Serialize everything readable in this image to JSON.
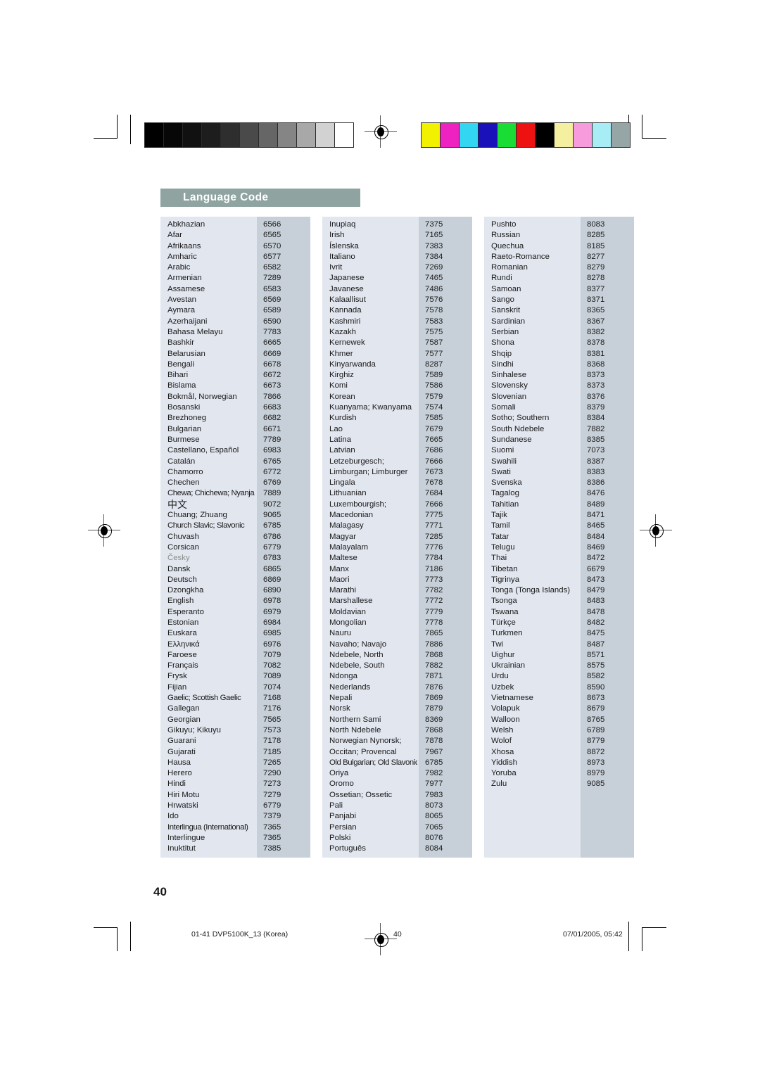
{
  "page": {
    "heading": "Language Code",
    "page_number": "40",
    "accent_header_color": "#8fa4a0",
    "name_column_color": "#e2e6ef",
    "code_column_color": "#c7d0d8"
  },
  "footer": {
    "file": "01-41 DVP5100K_13 (Korea)",
    "page": "40",
    "date": "07/01/2005, 05:42"
  },
  "calibration": {
    "grayscale": [
      "#000000",
      "#070707",
      "#111111",
      "#1d1d1d",
      "#2e2e2e",
      "#4a4a4a",
      "#666666",
      "#858585",
      "#a8a8a8",
      "#d2d2d2",
      "#ffffff"
    ],
    "colors": [
      "#f2f200",
      "#ee22c0",
      "#33d6f2",
      "#1a11bb",
      "#19dd34",
      "#ee1111",
      "#000000",
      "#f5f0a0",
      "#f79bdd",
      "#a8ecf5",
      "#96a5a5"
    ]
  },
  "table": {
    "columns": [
      {
        "id": "column-1",
        "rows": [
          {
            "name": "Abkhazian",
            "code": "6566"
          },
          {
            "name": "Afar",
            "code": "6565"
          },
          {
            "name": "Afrikaans",
            "code": "6570"
          },
          {
            "name": "Amharic",
            "code": "6577"
          },
          {
            "name": "Arabic",
            "code": "6582"
          },
          {
            "name": "Armenian",
            "code": "7289"
          },
          {
            "name": "Assamese",
            "code": "6583"
          },
          {
            "name": "Avestan",
            "code": "6569"
          },
          {
            "name": "Aymara",
            "code": "6589"
          },
          {
            "name": "Azerhaijani",
            "code": "6590"
          },
          {
            "name": "Bahasa Melayu",
            "code": "7783"
          },
          {
            "name": "Bashkir",
            "code": "6665"
          },
          {
            "name": "Belarusian",
            "code": "6669"
          },
          {
            "name": "Bengali",
            "code": "6678"
          },
          {
            "name": "Bihari",
            "code": "6672"
          },
          {
            "name": "Bislama",
            "code": "6673"
          },
          {
            "name": "Bokmål, Norwegian",
            "code": "7866"
          },
          {
            "name": "Bosanski",
            "code": "6683"
          },
          {
            "name": "Brezhoneg",
            "code": "6682"
          },
          {
            "name": "Bulgarian",
            "code": "6671"
          },
          {
            "name": "Burmese",
            "code": "7789"
          },
          {
            "name": "Castellano, Español",
            "code": "6983"
          },
          {
            "name": "Catalán",
            "code": "6765"
          },
          {
            "name": "Chamorro",
            "code": "6772"
          },
          {
            "name": "Chechen",
            "code": "6769"
          },
          {
            "name": "Chewa; Chichewa; Nyanja",
            "code": "7889"
          },
          {
            "name": "中文",
            "code": "9072"
          },
          {
            "name": "Chuang; Zhuang",
            "code": "9065"
          },
          {
            "name": "Church Slavic; Slavonic",
            "code": "6785"
          },
          {
            "name": "Chuvash",
            "code": "6786"
          },
          {
            "name": "Corsican",
            "code": "6779"
          },
          {
            "name": "Česky",
            "code": "6783"
          },
          {
            "name": "Dansk",
            "code": "6865"
          },
          {
            "name": "Deutsch",
            "code": "6869"
          },
          {
            "name": "Dzongkha",
            "code": "6890"
          },
          {
            "name": "English",
            "code": "6978"
          },
          {
            "name": "Esperanto",
            "code": "6979"
          },
          {
            "name": "Estonian",
            "code": "6984"
          },
          {
            "name": "Euskara",
            "code": "6985"
          },
          {
            "name": "Ελληνικά",
            "code": "6976"
          },
          {
            "name": "Faroese",
            "code": "7079"
          },
          {
            "name": "Français",
            "code": "7082"
          },
          {
            "name": "Frysk",
            "code": "7089"
          },
          {
            "name": "Fijian",
            "code": "7074"
          },
          {
            "name": "Gaelic; Scottish Gaelic",
            "code": "7168"
          },
          {
            "name": "Gallegan",
            "code": "7176"
          },
          {
            "name": "Georgian",
            "code": "7565"
          },
          {
            "name": "Gikuyu; Kikuyu",
            "code": "7573"
          },
          {
            "name": "Guarani",
            "code": "7178"
          },
          {
            "name": "Gujarati",
            "code": "7185"
          },
          {
            "name": "Hausa",
            "code": "7265"
          },
          {
            "name": "Herero",
            "code": "7290"
          },
          {
            "name": "Hindi",
            "code": "7273"
          },
          {
            "name": "Hiri Motu",
            "code": "7279"
          },
          {
            "name": "Hrwatski",
            "code": "6779"
          },
          {
            "name": "Ido",
            "code": "7379"
          },
          {
            "name": "Interlingua (International)",
            "code": "7365"
          },
          {
            "name": "Interlingue",
            "code": "7365"
          },
          {
            "name": "Inuktitut",
            "code": "7385"
          }
        ]
      },
      {
        "id": "column-2",
        "rows": [
          {
            "name": "Inupiaq",
            "code": "7375"
          },
          {
            "name": "Irish",
            "code": "7165"
          },
          {
            "name": "Íslenska",
            "code": "7383"
          },
          {
            "name": "Italiano",
            "code": "7384"
          },
          {
            "name": "Ivrit",
            "code": "7269"
          },
          {
            "name": "Japanese",
            "code": "7465"
          },
          {
            "name": "Javanese",
            "code": "7486"
          },
          {
            "name": "Kalaallisut",
            "code": "7576"
          },
          {
            "name": "Kannada",
            "code": "7578"
          },
          {
            "name": "Kashmiri",
            "code": "7583"
          },
          {
            "name": "Kazakh",
            "code": "7575"
          },
          {
            "name": "Kernewek",
            "code": "7587"
          },
          {
            "name": "Khmer",
            "code": "7577"
          },
          {
            "name": "Kinyarwanda",
            "code": "8287"
          },
          {
            "name": "Kirghiz",
            "code": "7589"
          },
          {
            "name": "Komi",
            "code": "7586"
          },
          {
            "name": "Korean",
            "code": "7579"
          },
          {
            "name": "Kuanyama; Kwanyama",
            "code": "7574"
          },
          {
            "name": "Kurdish",
            "code": "7585"
          },
          {
            "name": "Lao",
            "code": "7679"
          },
          {
            "name": "Latina",
            "code": "7665"
          },
          {
            "name": "Latvian",
            "code": "7686"
          },
          {
            "name": "Letzeburgesch;",
            "code": "7666"
          },
          {
            "name": "Limburgan; Limburger",
            "code": "7673"
          },
          {
            "name": "Lingala",
            "code": "7678"
          },
          {
            "name": "Lithuanian",
            "code": "7684"
          },
          {
            "name": "Luxembourgish;",
            "code": "7666"
          },
          {
            "name": "Macedonian",
            "code": "7775"
          },
          {
            "name": "Malagasy",
            "code": "7771"
          },
          {
            "name": "Magyar",
            "code": "7285"
          },
          {
            "name": "Malayalam",
            "code": "7776"
          },
          {
            "name": "Maltese",
            "code": "7784"
          },
          {
            "name": "Manx",
            "code": "7186"
          },
          {
            "name": "Maori",
            "code": "7773"
          },
          {
            "name": "Marathi",
            "code": "7782"
          },
          {
            "name": "Marshallese",
            "code": "7772"
          },
          {
            "name": "Moldavian",
            "code": "7779"
          },
          {
            "name": "Mongolian",
            "code": "7778"
          },
          {
            "name": "Nauru",
            "code": "7865"
          },
          {
            "name": "Navaho; Navajo",
            "code": "7886"
          },
          {
            "name": "Ndebele, North",
            "code": "7868"
          },
          {
            "name": "Ndebele, South",
            "code": "7882"
          },
          {
            "name": "Ndonga",
            "code": "7871"
          },
          {
            "name": "Nederlands",
            "code": "7876"
          },
          {
            "name": "Nepali",
            "code": "7869"
          },
          {
            "name": "Norsk",
            "code": "7879"
          },
          {
            "name": "Northern Sami",
            "code": "8369"
          },
          {
            "name": "North Ndebele",
            "code": "7868"
          },
          {
            "name": "Norwegian Nynorsk;",
            "code": "7878"
          },
          {
            "name": "Occitan; Provencal",
            "code": "7967"
          },
          {
            "name": "Old Bulgarian; Old Slavonic",
            "code": "6785"
          },
          {
            "name": "Oriya",
            "code": "7982"
          },
          {
            "name": "Oromo",
            "code": "7977"
          },
          {
            "name": "Ossetian; Ossetic",
            "code": "7983"
          },
          {
            "name": "Pali",
            "code": "8073"
          },
          {
            "name": "Panjabi",
            "code": "8065"
          },
          {
            "name": "Persian",
            "code": "7065"
          },
          {
            "name": "Polski",
            "code": "8076"
          },
          {
            "name": "Português",
            "code": "8084"
          }
        ]
      },
      {
        "id": "column-3",
        "rows": [
          {
            "name": "Pushto",
            "code": "8083"
          },
          {
            "name": "Russian",
            "code": "8285"
          },
          {
            "name": "Quechua",
            "code": "8185"
          },
          {
            "name": "Raeto-Romance",
            "code": "8277"
          },
          {
            "name": "Romanian",
            "code": "8279"
          },
          {
            "name": "Rundi",
            "code": "8278"
          },
          {
            "name": "Samoan",
            "code": "8377"
          },
          {
            "name": "Sango",
            "code": "8371"
          },
          {
            "name": "Sanskrit",
            "code": "8365"
          },
          {
            "name": "Sardinian",
            "code": "8367"
          },
          {
            "name": "Serbian",
            "code": "8382"
          },
          {
            "name": "Shona",
            "code": "8378"
          },
          {
            "name": "Shqip",
            "code": "8381"
          },
          {
            "name": "Sindhi",
            "code": "8368"
          },
          {
            "name": "Sinhalese",
            "code": "8373"
          },
          {
            "name": "Slovensky",
            "code": "8373"
          },
          {
            "name": "Slovenian",
            "code": "8376"
          },
          {
            "name": "Somali",
            "code": "8379"
          },
          {
            "name": "Sotho; Southern",
            "code": "8384"
          },
          {
            "name": "South Ndebele",
            "code": "7882"
          },
          {
            "name": "Sundanese",
            "code": "8385"
          },
          {
            "name": "Suomi",
            "code": "7073"
          },
          {
            "name": "Swahili",
            "code": "8387"
          },
          {
            "name": "Swati",
            "code": "8383"
          },
          {
            "name": "Svenska",
            "code": "8386"
          },
          {
            "name": "Tagalog",
            "code": "8476"
          },
          {
            "name": "Tahitian",
            "code": "8489"
          },
          {
            "name": "Tajik",
            "code": "8471"
          },
          {
            "name": "Tamil",
            "code": "8465"
          },
          {
            "name": "Tatar",
            "code": "8484"
          },
          {
            "name": "Telugu",
            "code": "8469"
          },
          {
            "name": "Thai",
            "code": "8472"
          },
          {
            "name": "Tibetan",
            "code": "6679"
          },
          {
            "name": "Tigrinya",
            "code": "8473"
          },
          {
            "name": "Tonga (Tonga Islands)",
            "code": "8479"
          },
          {
            "name": "Tsonga",
            "code": "8483"
          },
          {
            "name": "Tswana",
            "code": "8478"
          },
          {
            "name": "Türkçe",
            "code": "8482"
          },
          {
            "name": "Turkmen",
            "code": "8475"
          },
          {
            "name": "Twi",
            "code": "8487"
          },
          {
            "name": "Uighur",
            "code": "8571"
          },
          {
            "name": "Ukrainian",
            "code": "8575"
          },
          {
            "name": "Urdu",
            "code": "8582"
          },
          {
            "name": "Uzbek",
            "code": "8590"
          },
          {
            "name": "Vietnamese",
            "code": "8673"
          },
          {
            "name": "Volapuk",
            "code": "8679"
          },
          {
            "name": "Walloon",
            "code": "8765"
          },
          {
            "name": "Welsh",
            "code": "6789"
          },
          {
            "name": "Wolof",
            "code": "8779"
          },
          {
            "name": "Xhosa",
            "code": "8872"
          },
          {
            "name": "Yiddish",
            "code": "8973"
          },
          {
            "name": "Yoruba",
            "code": "8979"
          },
          {
            "name": "Zulu",
            "code": "9085"
          }
        ]
      }
    ]
  }
}
